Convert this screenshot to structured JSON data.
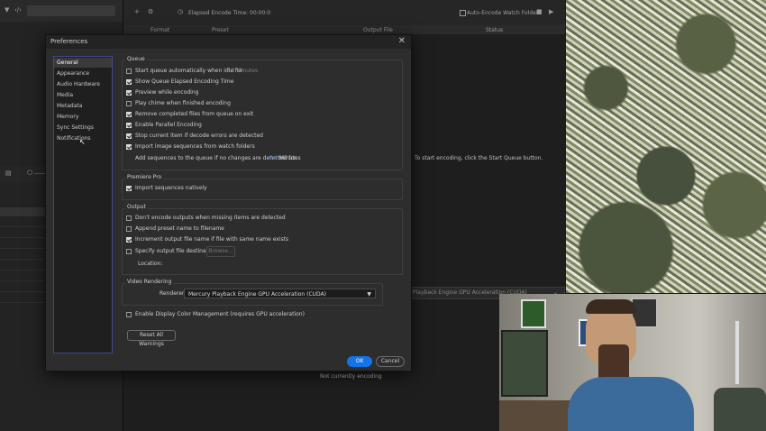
{
  "background": {
    "queue_toolbar": {
      "elapsed_label": "Elapsed Encode Time: 00:00:0",
      "watch_folders_label": "Auto-Encode Watch Folders"
    },
    "queue_headers": [
      "Format",
      "Preset",
      "Output File",
      "Status"
    ],
    "hint_text": "To start encoding, click the Start Queue button.",
    "renderer_text": "Playback Engine GPU Acceleration (CUDA)",
    "status_text": "Not currently encoding"
  },
  "dialog": {
    "title": "Preferences",
    "close_glyph": "✕",
    "nav": {
      "items": [
        "General",
        "Appearance",
        "Audio Hardware",
        "Media",
        "Metadata",
        "Memory",
        "Sync Settings",
        "Notifications"
      ],
      "selected": "General"
    },
    "queue": {
      "label": "Queue",
      "options": [
        {
          "label": "Start queue automatically when idle for:",
          "checked": false,
          "suffix": "2.0 Minutes"
        },
        {
          "label": "Show Queue Elapsed Encoding Time",
          "checked": true
        },
        {
          "label": "Preview while encoding",
          "checked": true
        },
        {
          "label": "Play chime when finished encoding",
          "checked": false
        },
        {
          "label": "Remove completed files from queue on exit",
          "checked": true
        },
        {
          "label": "Enable Parallel Encoding",
          "checked": true
        },
        {
          "label": "Stop current item if decode errors are detected",
          "checked": true
        },
        {
          "label": "Import image sequences from watch folders",
          "checked": true
        }
      ],
      "add_sequences_label": "Add sequences to the queue if no changes are detected for:",
      "add_sequences_value": "2.0",
      "add_sequences_unit": "Minutes"
    },
    "premiere": {
      "label": "Premiere Pro",
      "options": [
        {
          "label": "Import sequences natively",
          "checked": true
        }
      ]
    },
    "output": {
      "label": "Output",
      "options": [
        {
          "label": "Don't encode outputs when missing items are detected",
          "checked": false
        },
        {
          "label": "Append preset name to filename",
          "checked": false
        },
        {
          "label": "Increment output file name if file with same name exists",
          "checked": true
        },
        {
          "label": "Specify output file destination:",
          "checked": false
        }
      ],
      "browse_label": "Browse...",
      "location_label": "Location:"
    },
    "video_rendering": {
      "label": "Video Rendering",
      "renderer_label": "Renderer:",
      "renderer_value": "Mercury Playback Engine GPU Acceleration (CUDA)"
    },
    "color_management": {
      "label": "Enable Display Color Management (requires GPU acceleration)",
      "checked": false
    },
    "reset_label": "Reset All Warnings",
    "ok_label": "OK",
    "cancel_label": "Cancel"
  },
  "colors": {
    "accent": "#1473e6",
    "value_blue": "#3a86ff",
    "dialog_bg": "#2d2d2d"
  }
}
